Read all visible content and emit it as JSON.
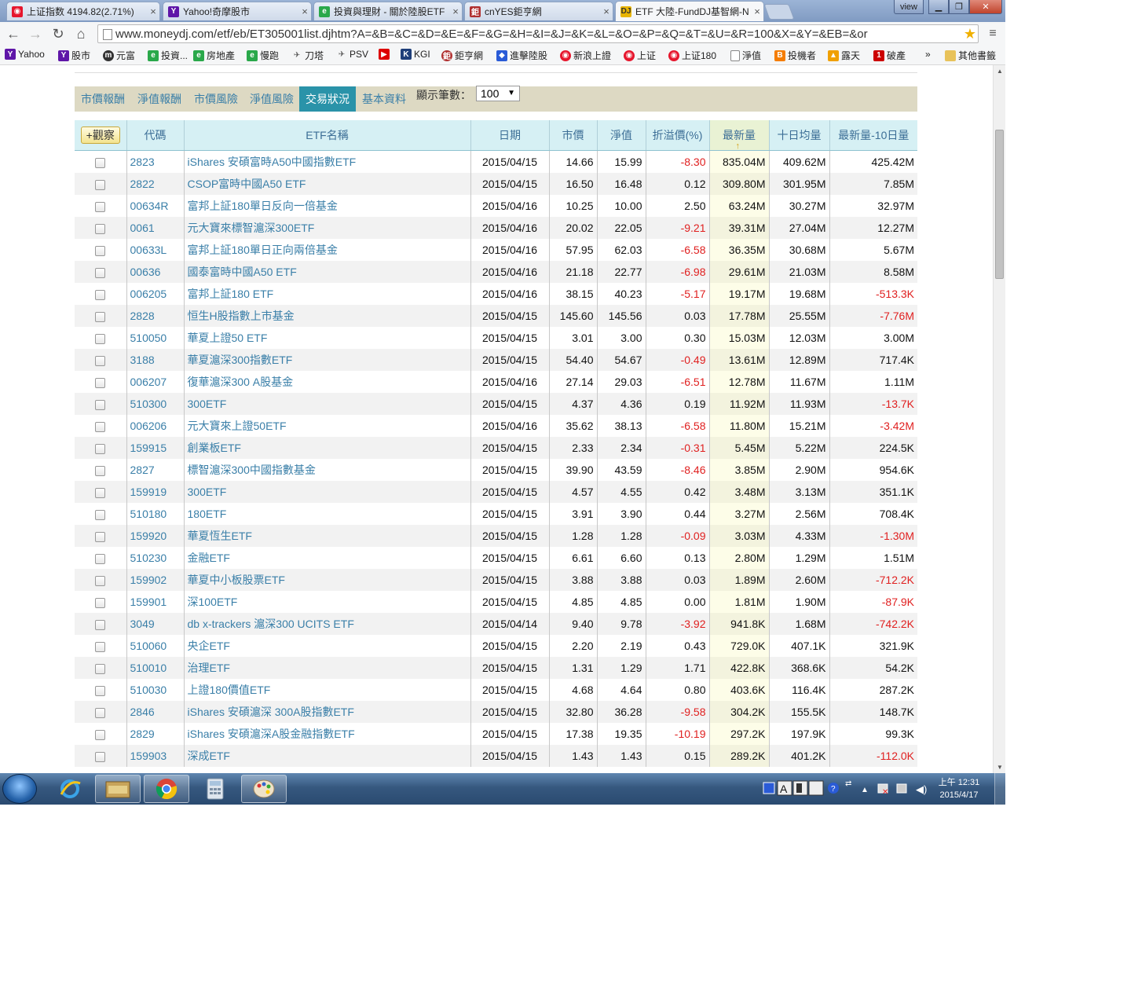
{
  "browser": {
    "tabs": [
      {
        "title": "上证指数 4194.82(2.71%)",
        "icon": "weibo-icon",
        "active": false
      },
      {
        "title": "Yahoo!奇摩股市",
        "icon": "yahoo-icon",
        "active": false
      },
      {
        "title": "投資與理財 - 關於陸股ETF",
        "icon": "site-icon",
        "active": false
      },
      {
        "title": "cnYES鉅亨網",
        "icon": "cnyes-icon",
        "active": false
      },
      {
        "title": "ETF 大陸-FundDJ基智網-N",
        "icon": "dj-icon",
        "active": true
      }
    ],
    "view_label": "view",
    "url": "www.moneydj.com/etf/eb/ET305001list.djhtm?A=&B=&C=&D=&E=&F=&G=&H=&I=&J=&K=&L=&O=&P=&Q=&T=&U=&R=100&X=&Y=&EB=&or",
    "bookmarks": [
      "Yahoo",
      "股市",
      "元富",
      "投資...",
      "房地產",
      "慢跑",
      "刀塔",
      "PSV",
      "",
      "KGI",
      "鉅亨網",
      "進擊陸股",
      "新浪上證",
      "上证",
      "上证180",
      "淨值",
      "投機者",
      "露天",
      "破產"
    ],
    "bookmarks_more": "»",
    "other_bookmarks": "其他書籤"
  },
  "page": {
    "nav_tabs": [
      "市價報酬",
      "淨值報酬",
      "市價風險",
      "淨值風險",
      "交易狀況",
      "基本資料"
    ],
    "active_tab": "交易狀況",
    "count_label": "顯示筆數：",
    "count_value": "100",
    "watch_button": "+觀察",
    "columns": [
      "代碼",
      "ETF名稱",
      "日期",
      "市價",
      "淨值",
      "折溢價(%)",
      "最新量",
      "十日均量",
      "最新量-10日量"
    ],
    "rows": [
      [
        "2823",
        "iShares 安碩富時A50中國指數ETF",
        "2015/04/15",
        "14.66",
        "15.99",
        "-8.30",
        "835.04M",
        "409.62M",
        "425.42M"
      ],
      [
        "2822",
        "CSOP富時中國A50 ETF",
        "2015/04/15",
        "16.50",
        "16.48",
        "0.12",
        "309.80M",
        "301.95M",
        "7.85M"
      ],
      [
        "00634R",
        "富邦上証180單日反向一倍基金",
        "2015/04/16",
        "10.25",
        "10.00",
        "2.50",
        "63.24M",
        "30.27M",
        "32.97M"
      ],
      [
        "0061",
        "元大寶來標智滬深300ETF",
        "2015/04/16",
        "20.02",
        "22.05",
        "-9.21",
        "39.31M",
        "27.04M",
        "12.27M"
      ],
      [
        "00633L",
        "富邦上証180單日正向兩倍基金",
        "2015/04/16",
        "57.95",
        "62.03",
        "-6.58",
        "36.35M",
        "30.68M",
        "5.67M"
      ],
      [
        "00636",
        "國泰富時中國A50 ETF",
        "2015/04/16",
        "21.18",
        "22.77",
        "-6.98",
        "29.61M",
        "21.03M",
        "8.58M"
      ],
      [
        "006205",
        "富邦上証180 ETF",
        "2015/04/16",
        "38.15",
        "40.23",
        "-5.17",
        "19.17M",
        "19.68M",
        "-513.3K"
      ],
      [
        "2828",
        "恒生H股指數上市基金",
        "2015/04/15",
        "145.60",
        "145.56",
        "0.03",
        "17.78M",
        "25.55M",
        "-7.76M"
      ],
      [
        "510050",
        "華夏上證50 ETF",
        "2015/04/15",
        "3.01",
        "3.00",
        "0.30",
        "15.03M",
        "12.03M",
        "3.00M"
      ],
      [
        "3188",
        "華夏滬深300指數ETF",
        "2015/04/15",
        "54.40",
        "54.67",
        "-0.49",
        "13.61M",
        "12.89M",
        "717.4K"
      ],
      [
        "006207",
        "復華滬深300 A股基金",
        "2015/04/16",
        "27.14",
        "29.03",
        "-6.51",
        "12.78M",
        "11.67M",
        "1.11M"
      ],
      [
        "510300",
        "300ETF",
        "2015/04/15",
        "4.37",
        "4.36",
        "0.19",
        "11.92M",
        "11.93M",
        "-13.7K"
      ],
      [
        "006206",
        "元大寶來上證50ETF",
        "2015/04/16",
        "35.62",
        "38.13",
        "-6.58",
        "11.80M",
        "15.21M",
        "-3.42M"
      ],
      [
        "159915",
        "創業板ETF",
        "2015/04/15",
        "2.33",
        "2.34",
        "-0.31",
        "5.45M",
        "5.22M",
        "224.5K"
      ],
      [
        "2827",
        "標智滬深300中國指數基金",
        "2015/04/15",
        "39.90",
        "43.59",
        "-8.46",
        "3.85M",
        "2.90M",
        "954.6K"
      ],
      [
        "159919",
        "300ETF",
        "2015/04/15",
        "4.57",
        "4.55",
        "0.42",
        "3.48M",
        "3.13M",
        "351.1K"
      ],
      [
        "510180",
        "180ETF",
        "2015/04/15",
        "3.91",
        "3.90",
        "0.44",
        "3.27M",
        "2.56M",
        "708.4K"
      ],
      [
        "159920",
        "華夏恆生ETF",
        "2015/04/15",
        "1.28",
        "1.28",
        "-0.09",
        "3.03M",
        "4.33M",
        "-1.30M"
      ],
      [
        "510230",
        "金融ETF",
        "2015/04/15",
        "6.61",
        "6.60",
        "0.13",
        "2.80M",
        "1.29M",
        "1.51M"
      ],
      [
        "159902",
        "華夏中小板股票ETF",
        "2015/04/15",
        "3.88",
        "3.88",
        "0.03",
        "1.89M",
        "2.60M",
        "-712.2K"
      ],
      [
        "159901",
        "深100ETF",
        "2015/04/15",
        "4.85",
        "4.85",
        "0.00",
        "1.81M",
        "1.90M",
        "-87.9K"
      ],
      [
        "3049",
        "db x-trackers 滬深300 UCITS ETF",
        "2015/04/14",
        "9.40",
        "9.78",
        "-3.92",
        "941.8K",
        "1.68M",
        "-742.2K"
      ],
      [
        "510060",
        "央企ETF",
        "2015/04/15",
        "2.20",
        "2.19",
        "0.43",
        "729.0K",
        "407.1K",
        "321.9K"
      ],
      [
        "510010",
        "治理ETF",
        "2015/04/15",
        "1.31",
        "1.29",
        "1.71",
        "422.8K",
        "368.6K",
        "54.2K"
      ],
      [
        "510030",
        "上證180價值ETF",
        "2015/04/15",
        "4.68",
        "4.64",
        "0.80",
        "403.6K",
        "116.4K",
        "287.2K"
      ],
      [
        "2846",
        "iShares 安碩滬深 300A股指數ETF",
        "2015/04/15",
        "32.80",
        "36.28",
        "-9.58",
        "304.2K",
        "155.5K",
        "148.7K"
      ],
      [
        "2829",
        "iShares 安碩滬深A股金融指數ETF",
        "2015/04/15",
        "17.38",
        "19.35",
        "-10.19",
        "297.2K",
        "197.9K",
        "99.3K"
      ],
      [
        "159903",
        "深成ETF",
        "2015/04/15",
        "1.43",
        "1.43",
        "0.15",
        "289.2K",
        "401.2K",
        "-112.0K"
      ]
    ]
  },
  "taskbar": {
    "apps": [
      "ie-icon",
      "file-explorer-icon",
      "chrome-icon",
      "calculator-icon",
      "paint-icon"
    ],
    "clock_time": "上午 12:31",
    "clock_date": "2015/4/17"
  },
  "colors": {
    "accent": "#2a93a9",
    "link": "#3a7fa8",
    "negative": "#e02020",
    "navbar_bg": "#ddd9c3"
  }
}
